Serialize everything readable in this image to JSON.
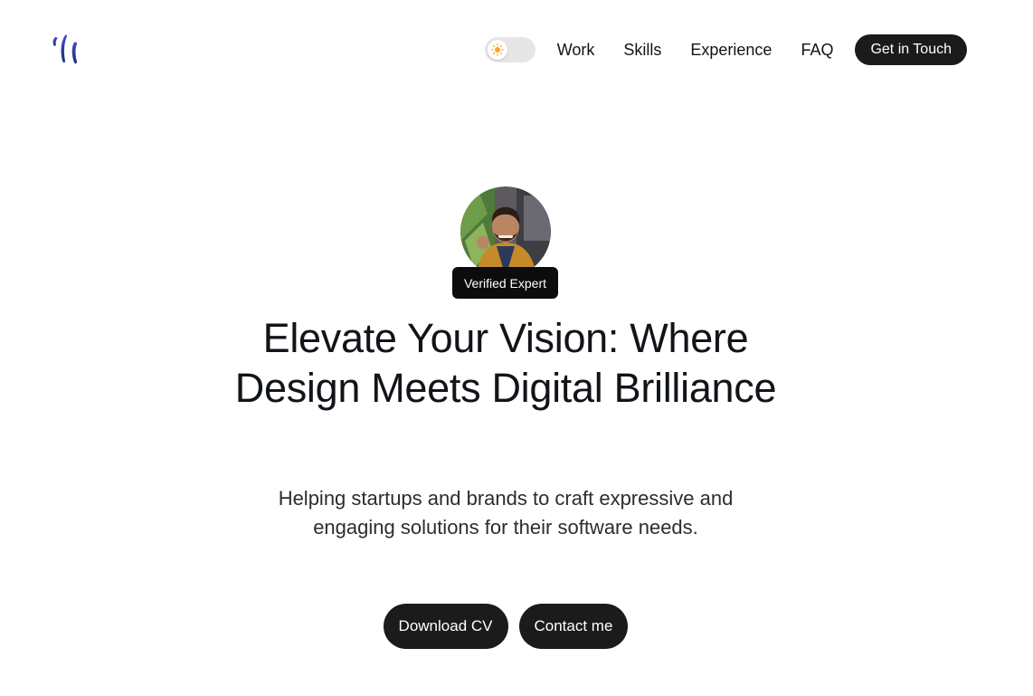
{
  "header": {
    "logo_icon": "brand-logo-icon",
    "theme_toggle": {
      "icon": "sun-icon",
      "state": "light"
    },
    "nav": [
      {
        "label": "Work"
      },
      {
        "label": "Skills"
      },
      {
        "label": "Experience"
      },
      {
        "label": "FAQ"
      }
    ],
    "cta_label": "Get in Touch"
  },
  "hero": {
    "avatar": "profile-photo",
    "badge": "Verified Expert",
    "headline": "Elevate Your Vision: Where Design Meets Digital Brilliance",
    "subtitle": "Helping startups and brands to craft expressive and engaging solutions for their software needs.",
    "buttons": {
      "download_cv": "Download CV",
      "contact": "Contact me"
    }
  },
  "colors": {
    "background": "#ffffff",
    "text": "#111418",
    "button_dark": "#1b1b1d",
    "logo_blue": "#2a3a96",
    "toggle_track": "#e6e6e9",
    "sun": "#f5a623"
  }
}
